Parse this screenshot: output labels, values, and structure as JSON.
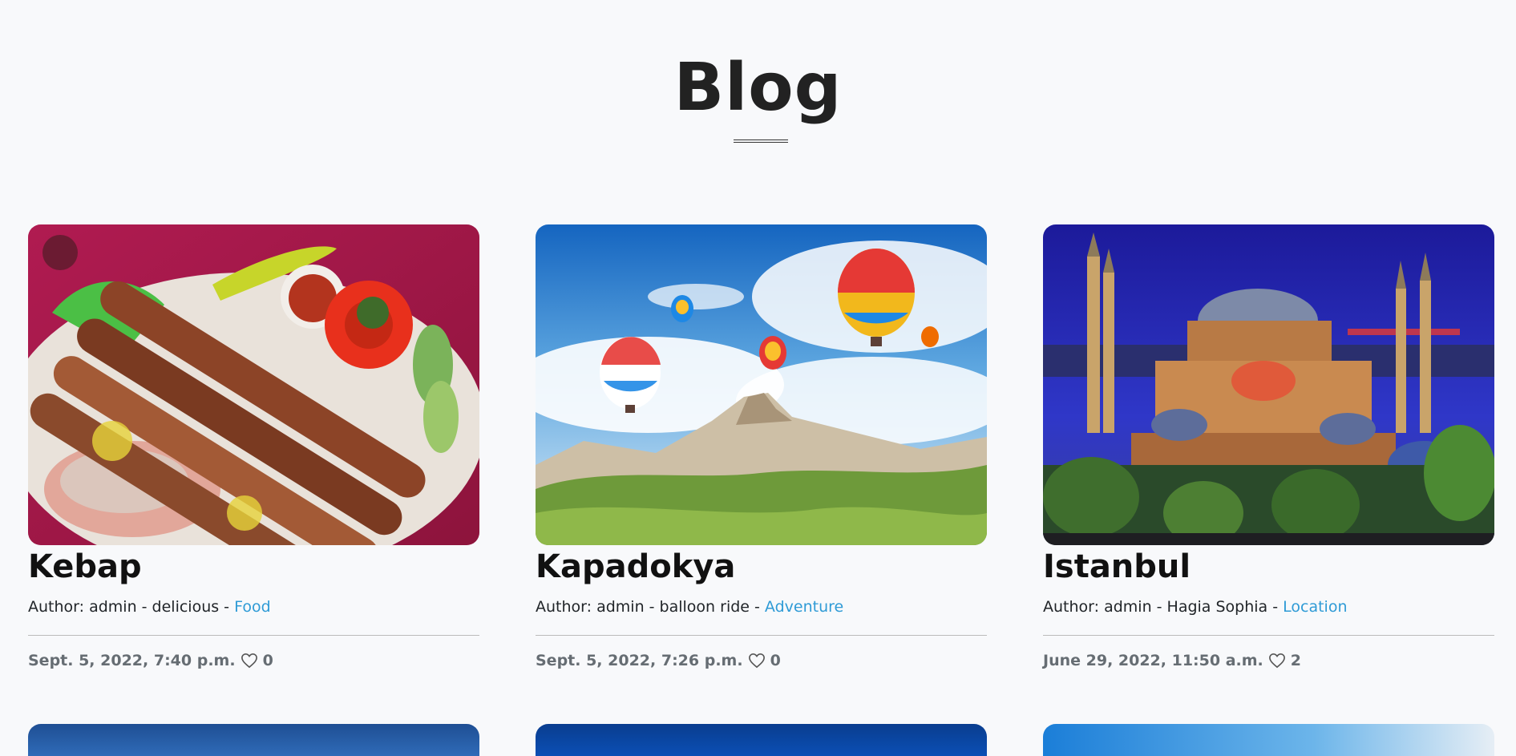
{
  "page": {
    "title": "Blog"
  },
  "posts": [
    {
      "title": "Kebap",
      "author_prefix": "Author: admin - delicious - ",
      "category": "Food",
      "date": "Sept. 5, 2022, 7:40 p.m.",
      "likes": "0",
      "image_alt": "kebab-plate-image"
    },
    {
      "title": "Kapadokya",
      "author_prefix": "Author: admin - balloon ride - ",
      "category": "Adventure",
      "date": "Sept. 5, 2022, 7:26 p.m.",
      "likes": "0",
      "image_alt": "cappadocia-balloons-image"
    },
    {
      "title": "Istanbul",
      "author_prefix": "Author: admin - Hagia Sophia - ",
      "category": "Location",
      "date": "June 29, 2022, 11:50 a.m.",
      "likes": "2",
      "image_alt": "hagia-sophia-night-image"
    }
  ],
  "colors": {
    "background": "#f8f9fb",
    "category_link": "#2f9bd6",
    "footer_text": "#666d73"
  },
  "icons": {
    "like": "heart-outline-icon"
  }
}
